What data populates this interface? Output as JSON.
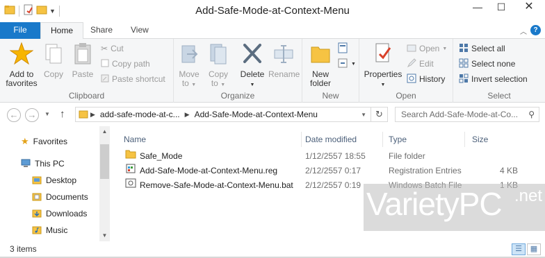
{
  "window": {
    "title": "Add-Safe-Mode-at-Context-Menu",
    "minimize": "—",
    "maximize": "☐",
    "close": "✕"
  },
  "ribbon_tabs": {
    "file": "File",
    "home": "Home",
    "share": "Share",
    "view": "View",
    "help": "?"
  },
  "clipboard": {
    "add_to_favorites_line1": "Add to",
    "add_to_favorites_line2": "favorites",
    "copy": "Copy",
    "paste": "Paste",
    "cut": "Cut",
    "copy_path": "Copy path",
    "paste_shortcut": "Paste shortcut",
    "group_label": "Clipboard"
  },
  "organize": {
    "move_to_line1": "Move",
    "move_to_line2": "to",
    "copy_to_line1": "Copy",
    "copy_to_line2": "to",
    "delete": "Delete",
    "rename": "Rename",
    "group_label": "Organize"
  },
  "new_group": {
    "new_folder_line1": "New",
    "new_folder_line2": "folder",
    "group_label": "New"
  },
  "open_group": {
    "properties": "Properties",
    "open": "Open",
    "edit": "Edit",
    "history": "History",
    "group_label": "Open"
  },
  "select_group": {
    "select_all": "Select all",
    "select_none": "Select none",
    "invert_selection": "Invert selection",
    "group_label": "Select"
  },
  "address": {
    "crumb1": "add-safe-mode-at-c...",
    "crumb2": "Add-Safe-Mode-at-Context-Menu",
    "search_placeholder": "Search Add-Safe-Mode-at-Co..."
  },
  "nav_pane": {
    "favorites": "Favorites",
    "this_pc": "This PC",
    "desktop": "Desktop",
    "documents": "Documents",
    "downloads": "Downloads",
    "music": "Music"
  },
  "columns": {
    "name": "Name",
    "date_modified": "Date modified",
    "type": "Type",
    "size": "Size"
  },
  "files": [
    {
      "name": "Safe_Mode",
      "date": "1/12/2557 18:55",
      "type": "File folder",
      "size": ""
    },
    {
      "name": "Add-Safe-Mode-at-Context-Menu.reg",
      "date": "2/12/2557 0:17",
      "type": "Registration Entries",
      "size": "4 KB"
    },
    {
      "name": "Remove-Safe-Mode-at-Context-Menu.bat",
      "date": "2/12/2557 0:19",
      "type": "Windows Batch File",
      "size": "1 KB"
    }
  ],
  "status": {
    "item_count": "3 items"
  },
  "watermark": {
    "brand": "VarietyPC",
    "tld": ".net"
  },
  "colors": {
    "accent": "#1979ca",
    "ribbon_bg": "#f5f6f7",
    "folder_yellow": "#f6c343"
  }
}
